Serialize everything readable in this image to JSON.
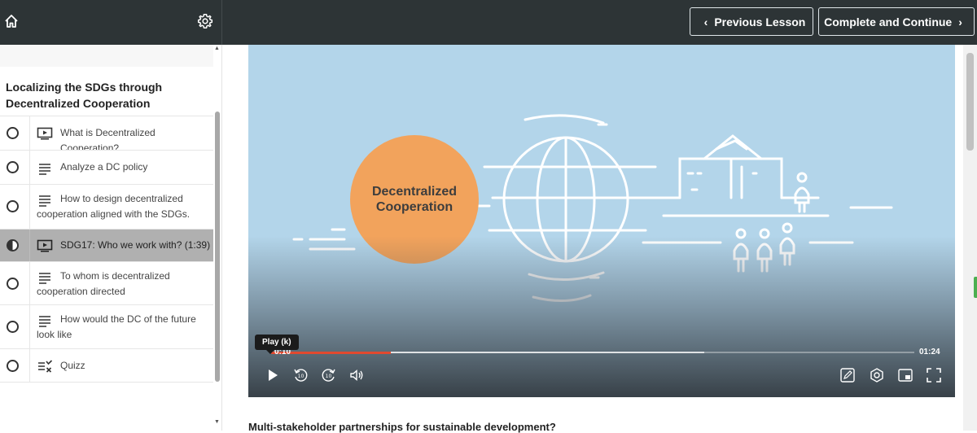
{
  "header": {
    "prev_label": "Previous Lesson",
    "next_label": "Complete and Continue"
  },
  "sidebar": {
    "chapter_title": "Localizing the SDGs through Decentralized Cooperation",
    "lessons": [
      {
        "label": "What is Decentralized Cooperation?",
        "icon": "video-icon",
        "status": "incomplete"
      },
      {
        "label": "Analyze a DC policy",
        "icon": "text-icon",
        "status": "incomplete"
      },
      {
        "label": "How to design decentralized cooperation aligned with the SDGs.",
        "icon": "text-icon",
        "status": "incomplete"
      },
      {
        "label": "SDG17: Who we work with? (1:39)",
        "icon": "video-icon",
        "status": "in-progress"
      },
      {
        "label": "To whom is decentralized cooperation directed",
        "icon": "text-icon",
        "status": "incomplete"
      },
      {
        "label": "How would the DC of the future look like",
        "icon": "text-icon",
        "status": "incomplete"
      },
      {
        "label": "Quizz",
        "icon": "quiz-icon",
        "status": "incomplete"
      }
    ]
  },
  "video": {
    "slide_title_line1": "Decentralized",
    "slide_title_line2": "Cooperation",
    "current_time": "0:10",
    "duration": "01:24",
    "played_fraction": 0.186,
    "buffered_fraction": 0.673,
    "tooltip": "Play (k)"
  },
  "main": {
    "section_heading": "Multi-stakeholder partnerships for sustainable development?"
  },
  "colors": {
    "header_bg": "#2d3436",
    "video_bg": "#b3d5ea",
    "circle": "#f2a35c",
    "progress": "#e0492f"
  }
}
